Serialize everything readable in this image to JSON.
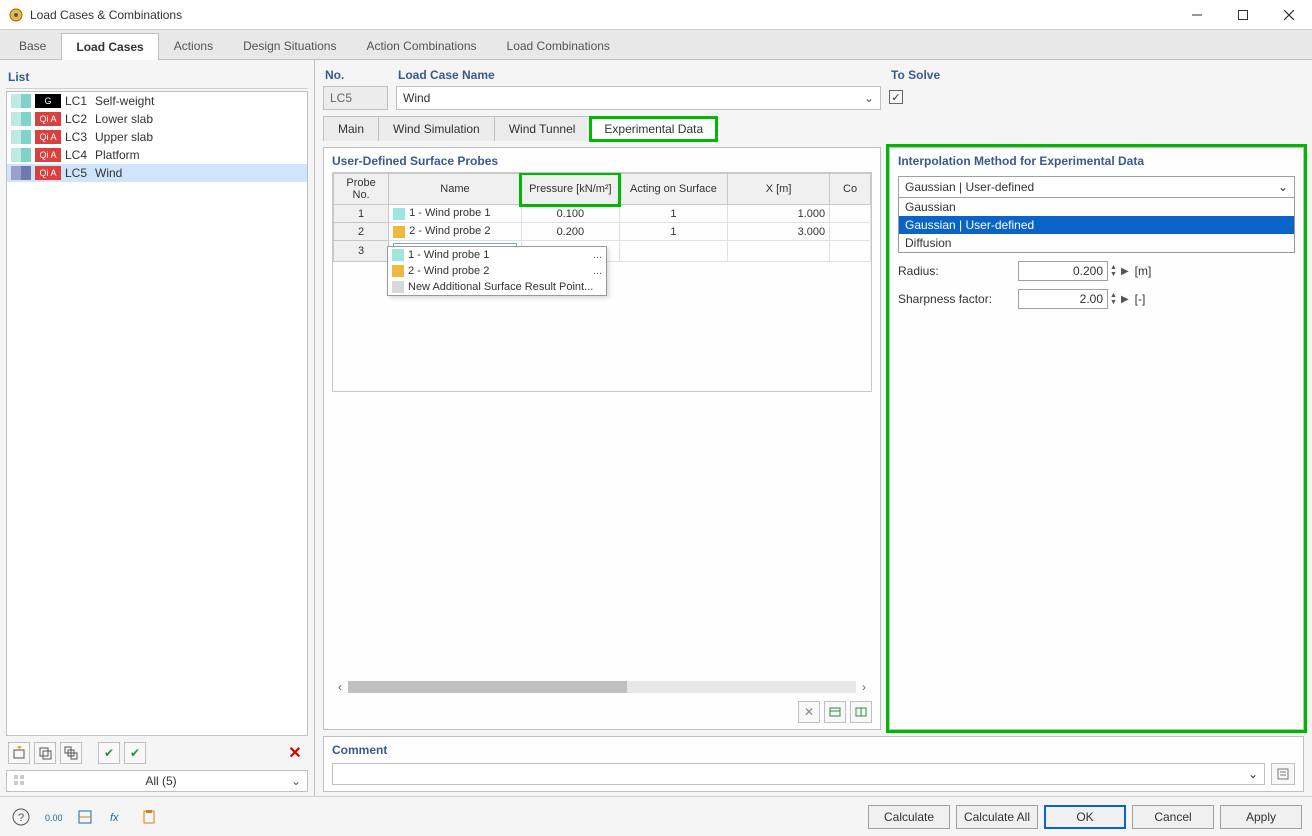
{
  "window": {
    "title": "Load Cases & Combinations"
  },
  "main_tabs": [
    "Base",
    "Load Cases",
    "Actions",
    "Design Situations",
    "Action Combinations",
    "Load Combinations"
  ],
  "main_tabs_active": 1,
  "list": {
    "header": "List",
    "items": [
      {
        "badge": "G",
        "badge_class": "badge-g",
        "swatches": [
          "#bfe9e3",
          "#7fd3c8"
        ],
        "code": "LC1",
        "name": "Self-weight"
      },
      {
        "badge": "Qi A",
        "badge_class": "badge-q",
        "swatches": [
          "#bfe9e3",
          "#7fd3c8"
        ],
        "code": "LC2",
        "name": "Lower slab"
      },
      {
        "badge": "Qi A",
        "badge_class": "badge-q",
        "swatches": [
          "#bfe9e3",
          "#7fd3c8"
        ],
        "code": "LC3",
        "name": "Upper slab"
      },
      {
        "badge": "Qi A",
        "badge_class": "badge-q",
        "swatches": [
          "#bfe9e3",
          "#7fd3c8"
        ],
        "code": "LC4",
        "name": "Platform"
      },
      {
        "badge": "Qi A",
        "badge_class": "badge-q",
        "swatches": [
          "#9aa1c8",
          "#6f78b0"
        ],
        "code": "LC5",
        "name": "Wind",
        "selected": true
      }
    ],
    "filter": "All (5)"
  },
  "header": {
    "no_label": "No.",
    "no_value": "LC5",
    "name_label": "Load Case Name",
    "name_value": "Wind",
    "solve_label": "To Solve"
  },
  "sub_tabs": [
    "Main",
    "Wind Simulation",
    "Wind Tunnel",
    "Experimental Data"
  ],
  "probes": {
    "title": "User-Defined Surface Probes",
    "cols": {
      "no": "Probe\nNo.",
      "name": "Name",
      "pressure": "Pressure [kN/m²]",
      "surface": "Acting on Surface",
      "x": "X [m]",
      "co": "Co"
    },
    "rows": [
      {
        "no": "1",
        "swatch": "#9fe6de",
        "name": "1 - Wind probe 1",
        "pressure": "0.100",
        "surface": "1",
        "x": "1.000"
      },
      {
        "no": "2",
        "swatch": "#f0b83c",
        "name": "2 - Wind probe 2",
        "pressure": "0.200",
        "surface": "1",
        "x": "3.000"
      },
      {
        "no": "3",
        "dropdown": true
      }
    ],
    "popup": [
      {
        "swatch": "#9fe6de",
        "label": "1 - Wind probe 1",
        "dots": "..."
      },
      {
        "swatch": "#f0b83c",
        "label": "2 - Wind probe 2",
        "dots": "..."
      },
      {
        "swatch": "#d8d8d8",
        "label": "New Additional Surface Result Point..."
      }
    ]
  },
  "interp": {
    "title": "Interpolation Method for Experimental Data",
    "selected": "Gaussian | User-defined",
    "options": [
      "Gaussian",
      "Gaussian | User-defined",
      "Diffusion"
    ],
    "radius_label": "Radius:",
    "radius_value": "0.200",
    "radius_unit": "[m]",
    "sharp_label": "Sharpness factor:",
    "sharp_value": "2.00",
    "sharp_unit": "[-]"
  },
  "comment": {
    "label": "Comment"
  },
  "footer": {
    "calculate": "Calculate",
    "calculate_all": "Calculate All",
    "ok": "OK",
    "cancel": "Cancel",
    "apply": "Apply"
  }
}
